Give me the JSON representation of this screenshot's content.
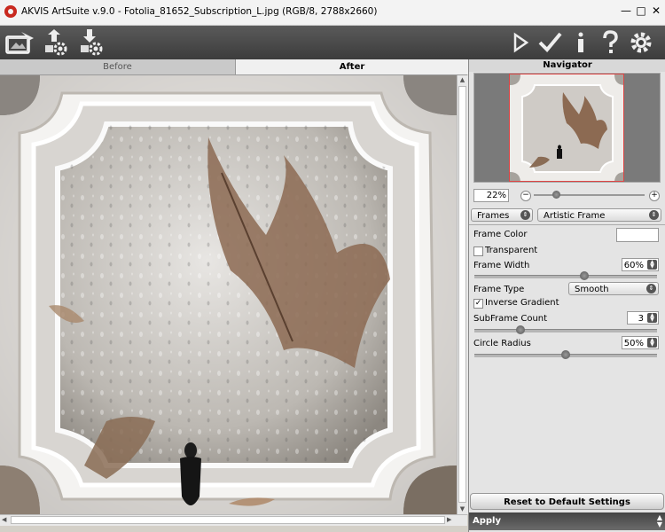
{
  "window": {
    "title": "AKVIS ArtSuite v.9.0 - Fotolia_81652_Subscription_L.jpg (RGB/8, 2788x2660)",
    "minimize": "—",
    "maximize": "□",
    "close": "✕"
  },
  "toolbar": {
    "left_icons": [
      "artsuite-logo-icon",
      "open-image-icon",
      "save-image-icon"
    ],
    "right_icons": [
      "run-icon",
      "apply-check-icon",
      "info-icon",
      "help-icon",
      "settings-gear-icon"
    ]
  },
  "tabs": [
    {
      "label": "Before",
      "active": false
    },
    {
      "label": "After",
      "active": true
    }
  ],
  "navigator": {
    "title": "Navigator",
    "zoom": "22%",
    "zoom_minus": "−",
    "zoom_plus": "+",
    "zoom_level": 0.2
  },
  "effect": {
    "category": "Frames",
    "preset": "Artistic Frame"
  },
  "settings": {
    "frame_color_label": "Frame Color",
    "frame_color_value": "#ffffff",
    "transparent_label": "Transparent",
    "transparent_checked": false,
    "frame_width_label": "Frame Width",
    "frame_width_value": "60%",
    "frame_width_level": 0.6,
    "frame_type_label": "Frame Type",
    "frame_type_value": "Smooth",
    "inverse_gradient_label": "Inverse Gradient",
    "inverse_gradient_checked": true,
    "subframe_count_label": "SubFrame Count",
    "subframe_count_value": "3",
    "subframe_count_level": 0.25,
    "circle_radius_label": "Circle Radius",
    "circle_radius_value": "50%",
    "circle_radius_level": 0.5
  },
  "buttons": {
    "reset": "Reset to Default Settings",
    "apply": "Apply"
  },
  "colors": {
    "accent_red": "#c8281e",
    "toolbar_dark": "#3c3c3c"
  }
}
